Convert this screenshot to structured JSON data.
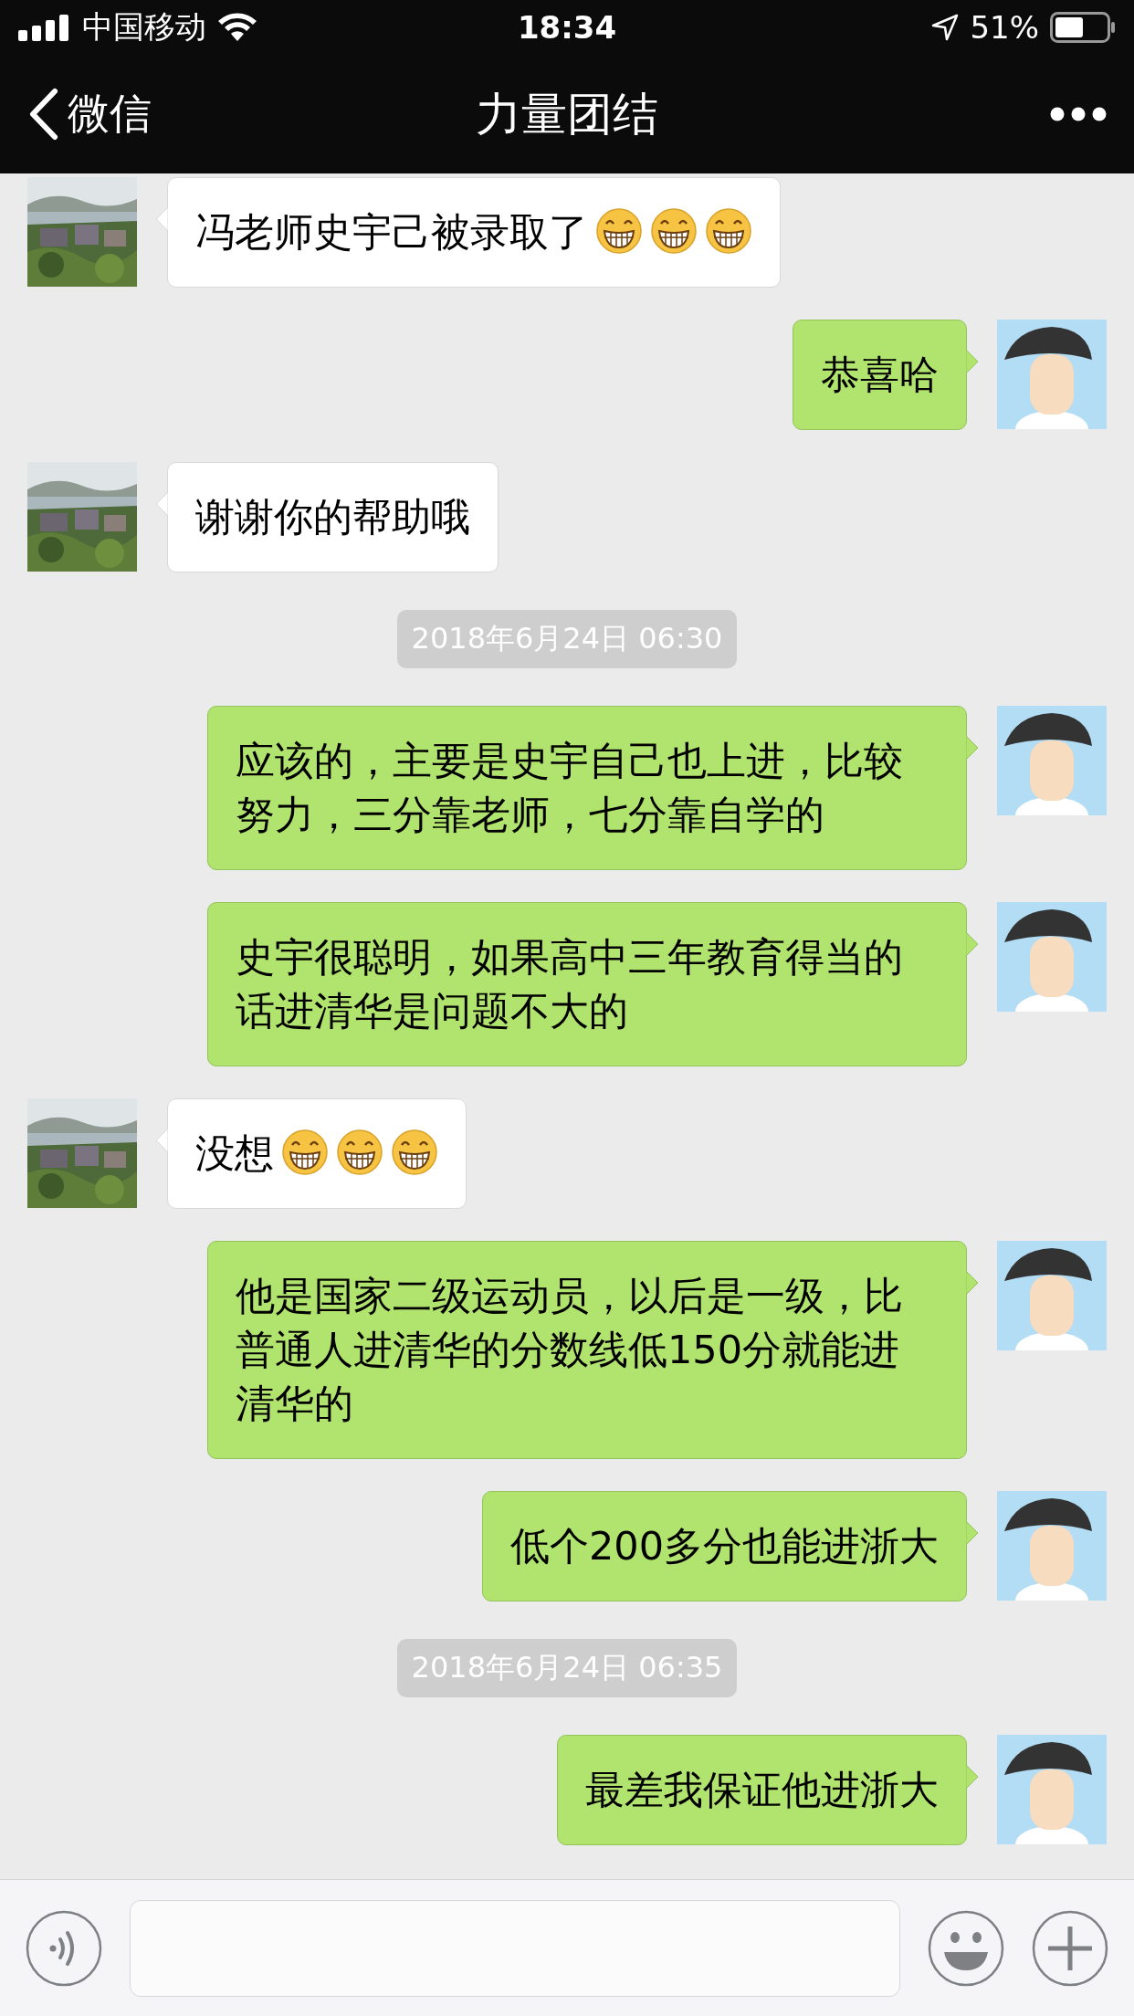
{
  "status_bar": {
    "carrier": "中国移动",
    "time": "18:34",
    "battery": "51%"
  },
  "nav": {
    "back": "微信",
    "title": "力量团结"
  },
  "messages": [
    {
      "kind": "message",
      "outgoing": false,
      "parts": [
        {
          "kind": "text",
          "text": "冯老师史宇己被录取了"
        },
        {
          "kind": "emoji"
        },
        {
          "kind": "emoji"
        },
        {
          "kind": "emoji"
        }
      ]
    },
    {
      "kind": "message",
      "outgoing": true,
      "parts": [
        {
          "kind": "text",
          "text": "恭喜哈"
        }
      ]
    },
    {
      "kind": "message",
      "outgoing": false,
      "parts": [
        {
          "kind": "text",
          "text": "谢谢你的帮助哦"
        }
      ]
    },
    {
      "kind": "time",
      "text": "2018年6月24日 06:30"
    },
    {
      "kind": "message",
      "outgoing": true,
      "parts": [
        {
          "kind": "text",
          "text": "应该的，主要是史宇自己也上进，比较努力，三分靠老师，七分靠自学的"
        }
      ]
    },
    {
      "kind": "message",
      "outgoing": true,
      "parts": [
        {
          "kind": "text",
          "text": "史宇很聪明，如果高中三年教育得当的话进清华是问题不大的"
        }
      ]
    },
    {
      "kind": "message",
      "outgoing": false,
      "parts": [
        {
          "kind": "text",
          "text": "没想"
        },
        {
          "kind": "emoji"
        },
        {
          "kind": "emoji"
        },
        {
          "kind": "emoji"
        }
      ]
    },
    {
      "kind": "message",
      "outgoing": true,
      "parts": [
        {
          "kind": "text",
          "text": "他是国家二级运动员，以后是一级，比普通人进清华的分数线低150分就能进清华的"
        }
      ]
    },
    {
      "kind": "message",
      "outgoing": true,
      "parts": [
        {
          "kind": "text",
          "text": "低个200多分也能进浙大"
        }
      ]
    },
    {
      "kind": "time",
      "text": "2018年6月24日 06:35"
    },
    {
      "kind": "message",
      "outgoing": true,
      "parts": [
        {
          "kind": "text",
          "text": "最差我保证他进浙大"
        }
      ]
    }
  ]
}
